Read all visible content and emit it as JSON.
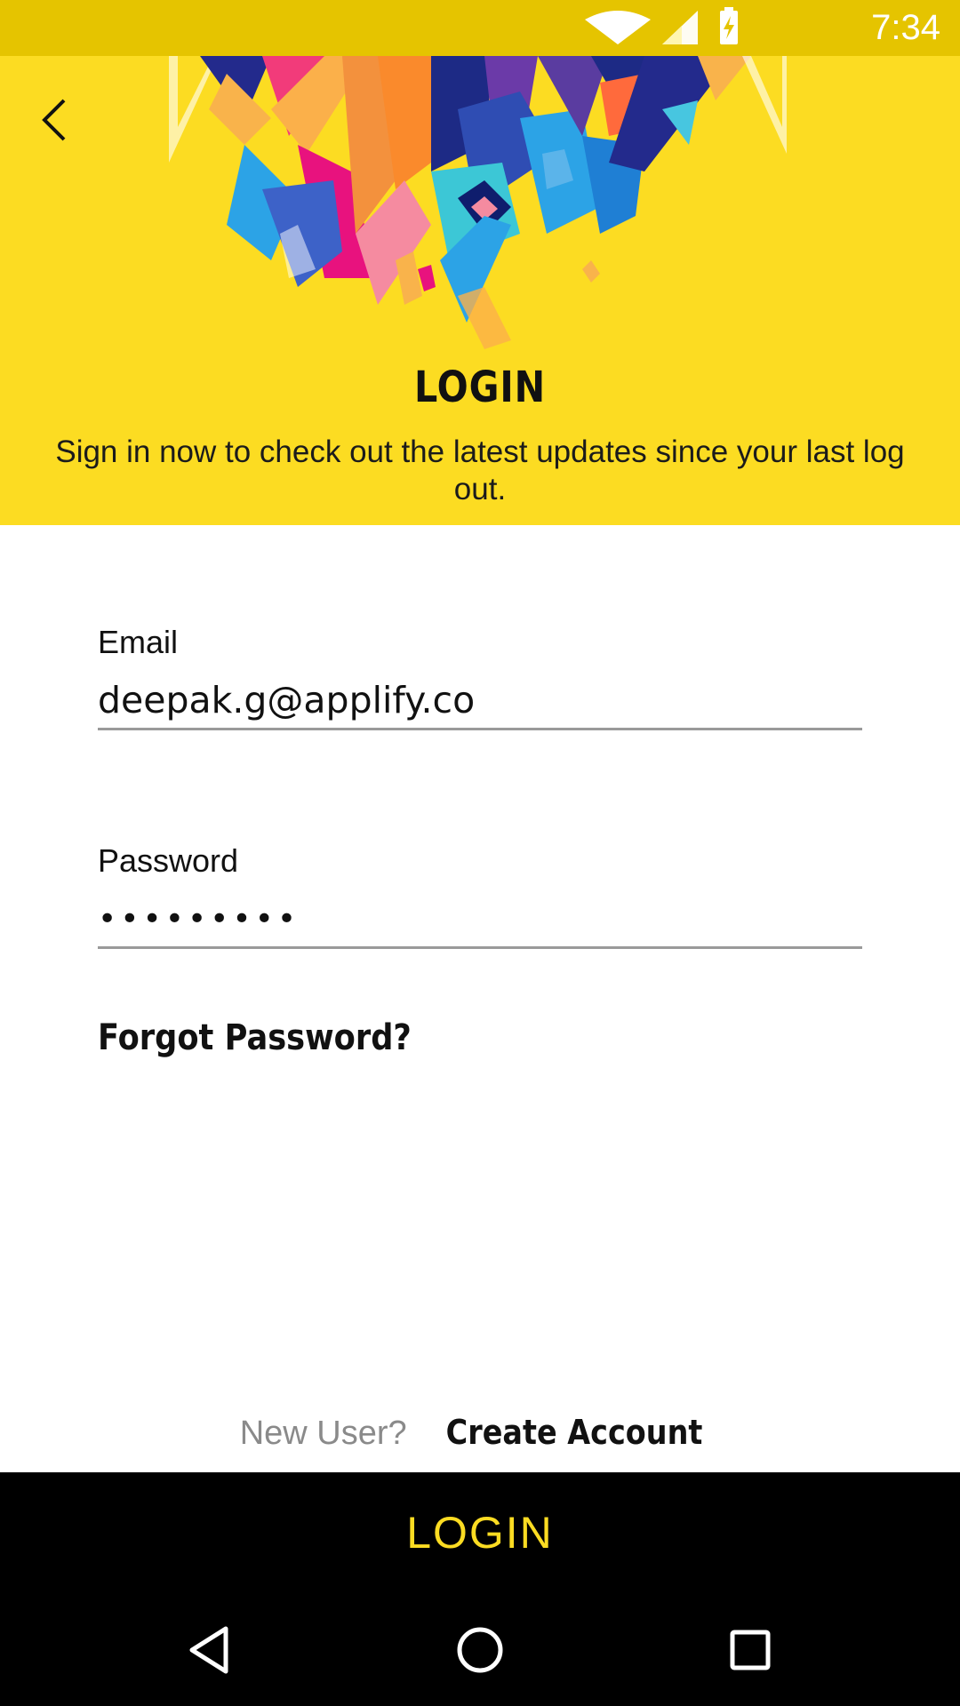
{
  "status_bar": {
    "time": "7:34",
    "icons": [
      "wifi-icon",
      "cellular-signal-icon",
      "battery-charging-icon"
    ],
    "background": "#e5c400"
  },
  "header": {
    "background": "#fcdc22",
    "back_icon": "chevron-left-icon",
    "title": "LOGIN",
    "subtitle": "Sign in now to check out the latest updates since your last log out."
  },
  "form": {
    "email": {
      "label": "Email",
      "value": "deepak.g@applify.co"
    },
    "password": {
      "label": "Password",
      "value": "•••••••••"
    },
    "forgot_password": "Forgot Password?"
  },
  "signup": {
    "prompt": "New User?",
    "link": "Create Account"
  },
  "login_button": {
    "label": "LOGIN",
    "text_color": "#fcdc22",
    "background": "#000000"
  },
  "nav_bar": {
    "icons": [
      "back-triangle-icon",
      "home-circle-icon",
      "recents-square-icon"
    ]
  }
}
